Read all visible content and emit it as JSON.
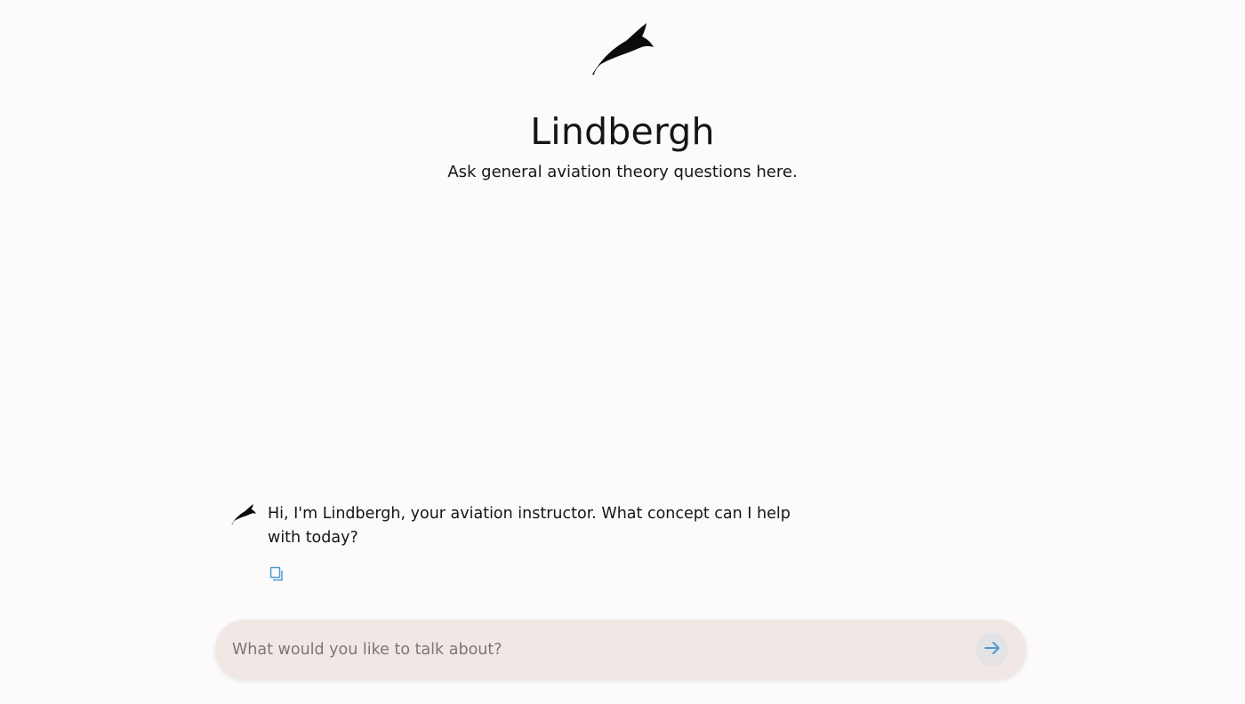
{
  "app": {
    "title": "Lindbergh",
    "subtitle": "Ask general aviation theory questions here.",
    "logo_icon": "feather-bird-icon"
  },
  "chat": {
    "messages": [
      {
        "role": "assistant",
        "avatar_icon": "feather-bird-icon",
        "text": "Hi, I'm Lindbergh, your aviation instructor. What concept can I help with today?",
        "action_icon": "copy-icon"
      }
    ]
  },
  "composer": {
    "placeholder": "What would you like to talk about?",
    "value": "",
    "send_icon": "arrow-right-icon"
  },
  "colors": {
    "background": "#fcfafa",
    "composer_bg": "#f1e8e6",
    "accent": "#4a9bd1",
    "send_button_bg": "#e5e2e6"
  }
}
